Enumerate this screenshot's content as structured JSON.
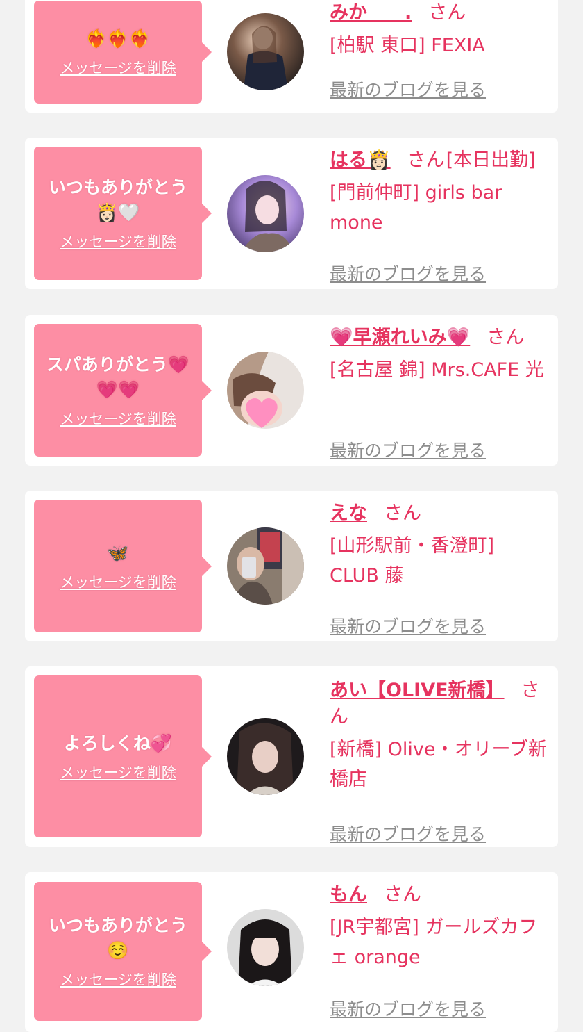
{
  "colors": {
    "page_background": "#f2f2f2",
    "card_background": "#ffffff",
    "bubble_pink": "#fd8ea4",
    "accent_pink": "#e6335f",
    "link_gray": "#8d8d8d"
  },
  "labels": {
    "delete_message": "メッセージを削除",
    "san": "さん",
    "latest_blog": "最新のブログを見る"
  },
  "entries": [
    {
      "message": "❤️‍🔥❤️‍🔥❤️‍🔥",
      "name": "みか　　.",
      "name_suffix": "",
      "shop": "[柏駅 東口] FEXIA"
    },
    {
      "message": "いつもありがとう👸🏻🤍",
      "name": "はる👸🏻",
      "name_suffix": "[本日出勤]",
      "shop": "[門前仲町] girls bar mone"
    },
    {
      "message": "スパありがとう💗💗💗",
      "name": "💗早瀬れいみ💗",
      "name_suffix": "",
      "shop": "[名古屋 錦] Mrs.CAFE 光"
    },
    {
      "message": "🦋",
      "name": "えな",
      "name_suffix": "",
      "shop": "[山形駅前・香澄町] CLUB 藤"
    },
    {
      "message": "よろしくね💞",
      "name": "あい【OLIVE新橋】",
      "name_suffix": "",
      "shop": "[新橋] Olive・オリーブ新橋店"
    },
    {
      "message": "いつもありがとう☺️",
      "name": "もん",
      "name_suffix": "",
      "shop": "[JR宇都宮] ガールズカフェ orange"
    }
  ]
}
